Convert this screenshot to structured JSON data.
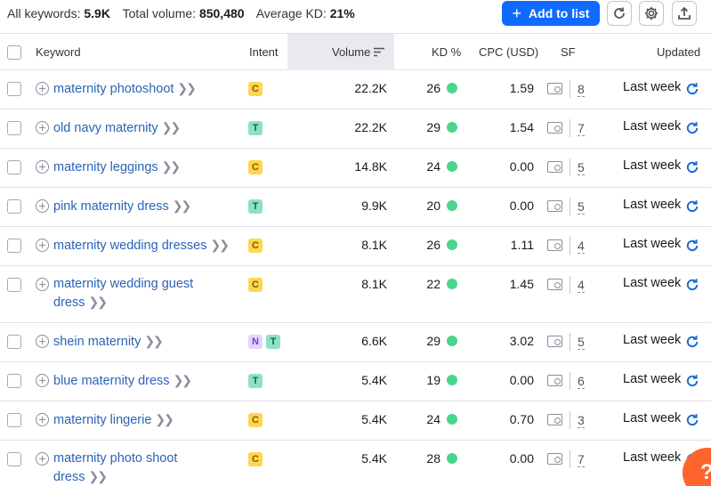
{
  "summary": {
    "keywords_label": "All keywords:",
    "keywords_value": "5.9K",
    "volume_label": "Total volume:",
    "volume_value": "850,480",
    "kd_label": "Average KD:",
    "kd_value": "21%"
  },
  "toolbar": {
    "add_label": "Add to list",
    "add_icon": "plus-icon",
    "refresh_icon": "refresh-icon",
    "settings_icon": "gear-icon",
    "export_icon": "export-icon"
  },
  "columns": {
    "keyword": "Keyword",
    "intent": "Intent",
    "volume": "Volume",
    "kd": "KD %",
    "cpc": "CPC (USD)",
    "sf": "SF",
    "updated": "Updated"
  },
  "colors": {
    "accent": "#0f6bff",
    "link": "#2a63b8",
    "kd_dot": "#48d68c",
    "help": "#ff642d"
  },
  "rows": [
    {
      "keyword": "maternity photoshoot",
      "intent": [
        "C"
      ],
      "volume": "22.2K",
      "kd": "26",
      "cpc": "1.59",
      "sf": "8",
      "updated": "Last week"
    },
    {
      "keyword": "old navy maternity",
      "intent": [
        "T"
      ],
      "volume": "22.2K",
      "kd": "29",
      "cpc": "1.54",
      "sf": "7",
      "updated": "Last week"
    },
    {
      "keyword": "maternity leggings",
      "intent": [
        "C"
      ],
      "volume": "14.8K",
      "kd": "24",
      "cpc": "0.00",
      "sf": "5",
      "updated": "Last week"
    },
    {
      "keyword": "pink maternity dress",
      "intent": [
        "T"
      ],
      "volume": "9.9K",
      "kd": "20",
      "cpc": "0.00",
      "sf": "5",
      "updated": "Last week"
    },
    {
      "keyword": "maternity wedding dresses",
      "intent": [
        "C"
      ],
      "volume": "8.1K",
      "kd": "26",
      "cpc": "1.11",
      "sf": "4",
      "updated": "Last week"
    },
    {
      "keyword": "maternity wedding guest dress",
      "intent": [
        "C"
      ],
      "volume": "8.1K",
      "kd": "22",
      "cpc": "1.45",
      "sf": "4",
      "updated": "Last week"
    },
    {
      "keyword": "shein maternity",
      "intent": [
        "N",
        "T"
      ],
      "volume": "6.6K",
      "kd": "29",
      "cpc": "3.02",
      "sf": "5",
      "updated": "Last week"
    },
    {
      "keyword": "blue maternity dress",
      "intent": [
        "T"
      ],
      "volume": "5.4K",
      "kd": "19",
      "cpc": "0.00",
      "sf": "6",
      "updated": "Last week"
    },
    {
      "keyword": "maternity lingerie",
      "intent": [
        "C"
      ],
      "volume": "5.4K",
      "kd": "24",
      "cpc": "0.70",
      "sf": "3",
      "updated": "Last week"
    },
    {
      "keyword": "maternity photo shoot dress",
      "intent": [
        "C"
      ],
      "volume": "5.4K",
      "kd": "28",
      "cpc": "0.00",
      "sf": "7",
      "updated": "Last week"
    }
  ],
  "help_label": "?"
}
